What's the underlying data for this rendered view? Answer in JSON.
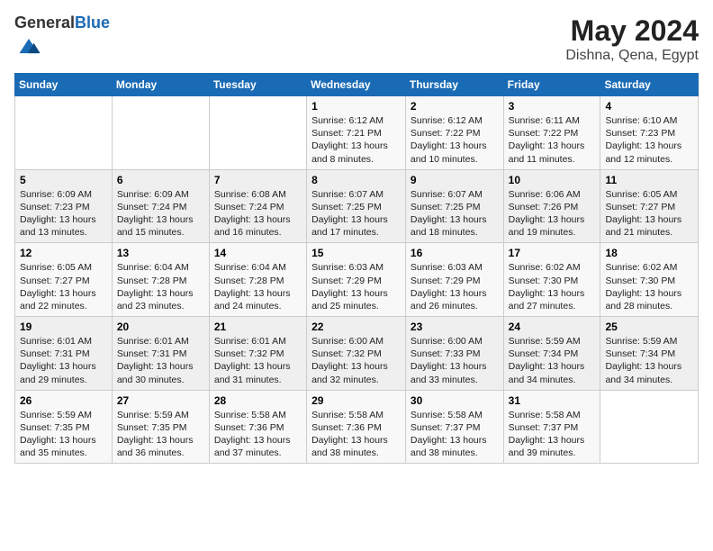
{
  "header": {
    "logo_general": "General",
    "logo_blue": "Blue",
    "month": "May 2024",
    "location": "Dishna, Qena, Egypt"
  },
  "days_of_week": [
    "Sunday",
    "Monday",
    "Tuesday",
    "Wednesday",
    "Thursday",
    "Friday",
    "Saturday"
  ],
  "weeks": [
    [
      {
        "day": "",
        "info": ""
      },
      {
        "day": "",
        "info": ""
      },
      {
        "day": "",
        "info": ""
      },
      {
        "day": "1",
        "info": "Sunrise: 6:12 AM\nSunset: 7:21 PM\nDaylight: 13 hours and 8 minutes."
      },
      {
        "day": "2",
        "info": "Sunrise: 6:12 AM\nSunset: 7:22 PM\nDaylight: 13 hours and 10 minutes."
      },
      {
        "day": "3",
        "info": "Sunrise: 6:11 AM\nSunset: 7:22 PM\nDaylight: 13 hours and 11 minutes."
      },
      {
        "day": "4",
        "info": "Sunrise: 6:10 AM\nSunset: 7:23 PM\nDaylight: 13 hours and 12 minutes."
      }
    ],
    [
      {
        "day": "5",
        "info": "Sunrise: 6:09 AM\nSunset: 7:23 PM\nDaylight: 13 hours and 13 minutes."
      },
      {
        "day": "6",
        "info": "Sunrise: 6:09 AM\nSunset: 7:24 PM\nDaylight: 13 hours and 15 minutes."
      },
      {
        "day": "7",
        "info": "Sunrise: 6:08 AM\nSunset: 7:24 PM\nDaylight: 13 hours and 16 minutes."
      },
      {
        "day": "8",
        "info": "Sunrise: 6:07 AM\nSunset: 7:25 PM\nDaylight: 13 hours and 17 minutes."
      },
      {
        "day": "9",
        "info": "Sunrise: 6:07 AM\nSunset: 7:25 PM\nDaylight: 13 hours and 18 minutes."
      },
      {
        "day": "10",
        "info": "Sunrise: 6:06 AM\nSunset: 7:26 PM\nDaylight: 13 hours and 19 minutes."
      },
      {
        "day": "11",
        "info": "Sunrise: 6:05 AM\nSunset: 7:27 PM\nDaylight: 13 hours and 21 minutes."
      }
    ],
    [
      {
        "day": "12",
        "info": "Sunrise: 6:05 AM\nSunset: 7:27 PM\nDaylight: 13 hours and 22 minutes."
      },
      {
        "day": "13",
        "info": "Sunrise: 6:04 AM\nSunset: 7:28 PM\nDaylight: 13 hours and 23 minutes."
      },
      {
        "day": "14",
        "info": "Sunrise: 6:04 AM\nSunset: 7:28 PM\nDaylight: 13 hours and 24 minutes."
      },
      {
        "day": "15",
        "info": "Sunrise: 6:03 AM\nSunset: 7:29 PM\nDaylight: 13 hours and 25 minutes."
      },
      {
        "day": "16",
        "info": "Sunrise: 6:03 AM\nSunset: 7:29 PM\nDaylight: 13 hours and 26 minutes."
      },
      {
        "day": "17",
        "info": "Sunrise: 6:02 AM\nSunset: 7:30 PM\nDaylight: 13 hours and 27 minutes."
      },
      {
        "day": "18",
        "info": "Sunrise: 6:02 AM\nSunset: 7:30 PM\nDaylight: 13 hours and 28 minutes."
      }
    ],
    [
      {
        "day": "19",
        "info": "Sunrise: 6:01 AM\nSunset: 7:31 PM\nDaylight: 13 hours and 29 minutes."
      },
      {
        "day": "20",
        "info": "Sunrise: 6:01 AM\nSunset: 7:31 PM\nDaylight: 13 hours and 30 minutes."
      },
      {
        "day": "21",
        "info": "Sunrise: 6:01 AM\nSunset: 7:32 PM\nDaylight: 13 hours and 31 minutes."
      },
      {
        "day": "22",
        "info": "Sunrise: 6:00 AM\nSunset: 7:32 PM\nDaylight: 13 hours and 32 minutes."
      },
      {
        "day": "23",
        "info": "Sunrise: 6:00 AM\nSunset: 7:33 PM\nDaylight: 13 hours and 33 minutes."
      },
      {
        "day": "24",
        "info": "Sunrise: 5:59 AM\nSunset: 7:34 PM\nDaylight: 13 hours and 34 minutes."
      },
      {
        "day": "25",
        "info": "Sunrise: 5:59 AM\nSunset: 7:34 PM\nDaylight: 13 hours and 34 minutes."
      }
    ],
    [
      {
        "day": "26",
        "info": "Sunrise: 5:59 AM\nSunset: 7:35 PM\nDaylight: 13 hours and 35 minutes."
      },
      {
        "day": "27",
        "info": "Sunrise: 5:59 AM\nSunset: 7:35 PM\nDaylight: 13 hours and 36 minutes."
      },
      {
        "day": "28",
        "info": "Sunrise: 5:58 AM\nSunset: 7:36 PM\nDaylight: 13 hours and 37 minutes."
      },
      {
        "day": "29",
        "info": "Sunrise: 5:58 AM\nSunset: 7:36 PM\nDaylight: 13 hours and 38 minutes."
      },
      {
        "day": "30",
        "info": "Sunrise: 5:58 AM\nSunset: 7:37 PM\nDaylight: 13 hours and 38 minutes."
      },
      {
        "day": "31",
        "info": "Sunrise: 5:58 AM\nSunset: 7:37 PM\nDaylight: 13 hours and 39 minutes."
      },
      {
        "day": "",
        "info": ""
      }
    ]
  ]
}
